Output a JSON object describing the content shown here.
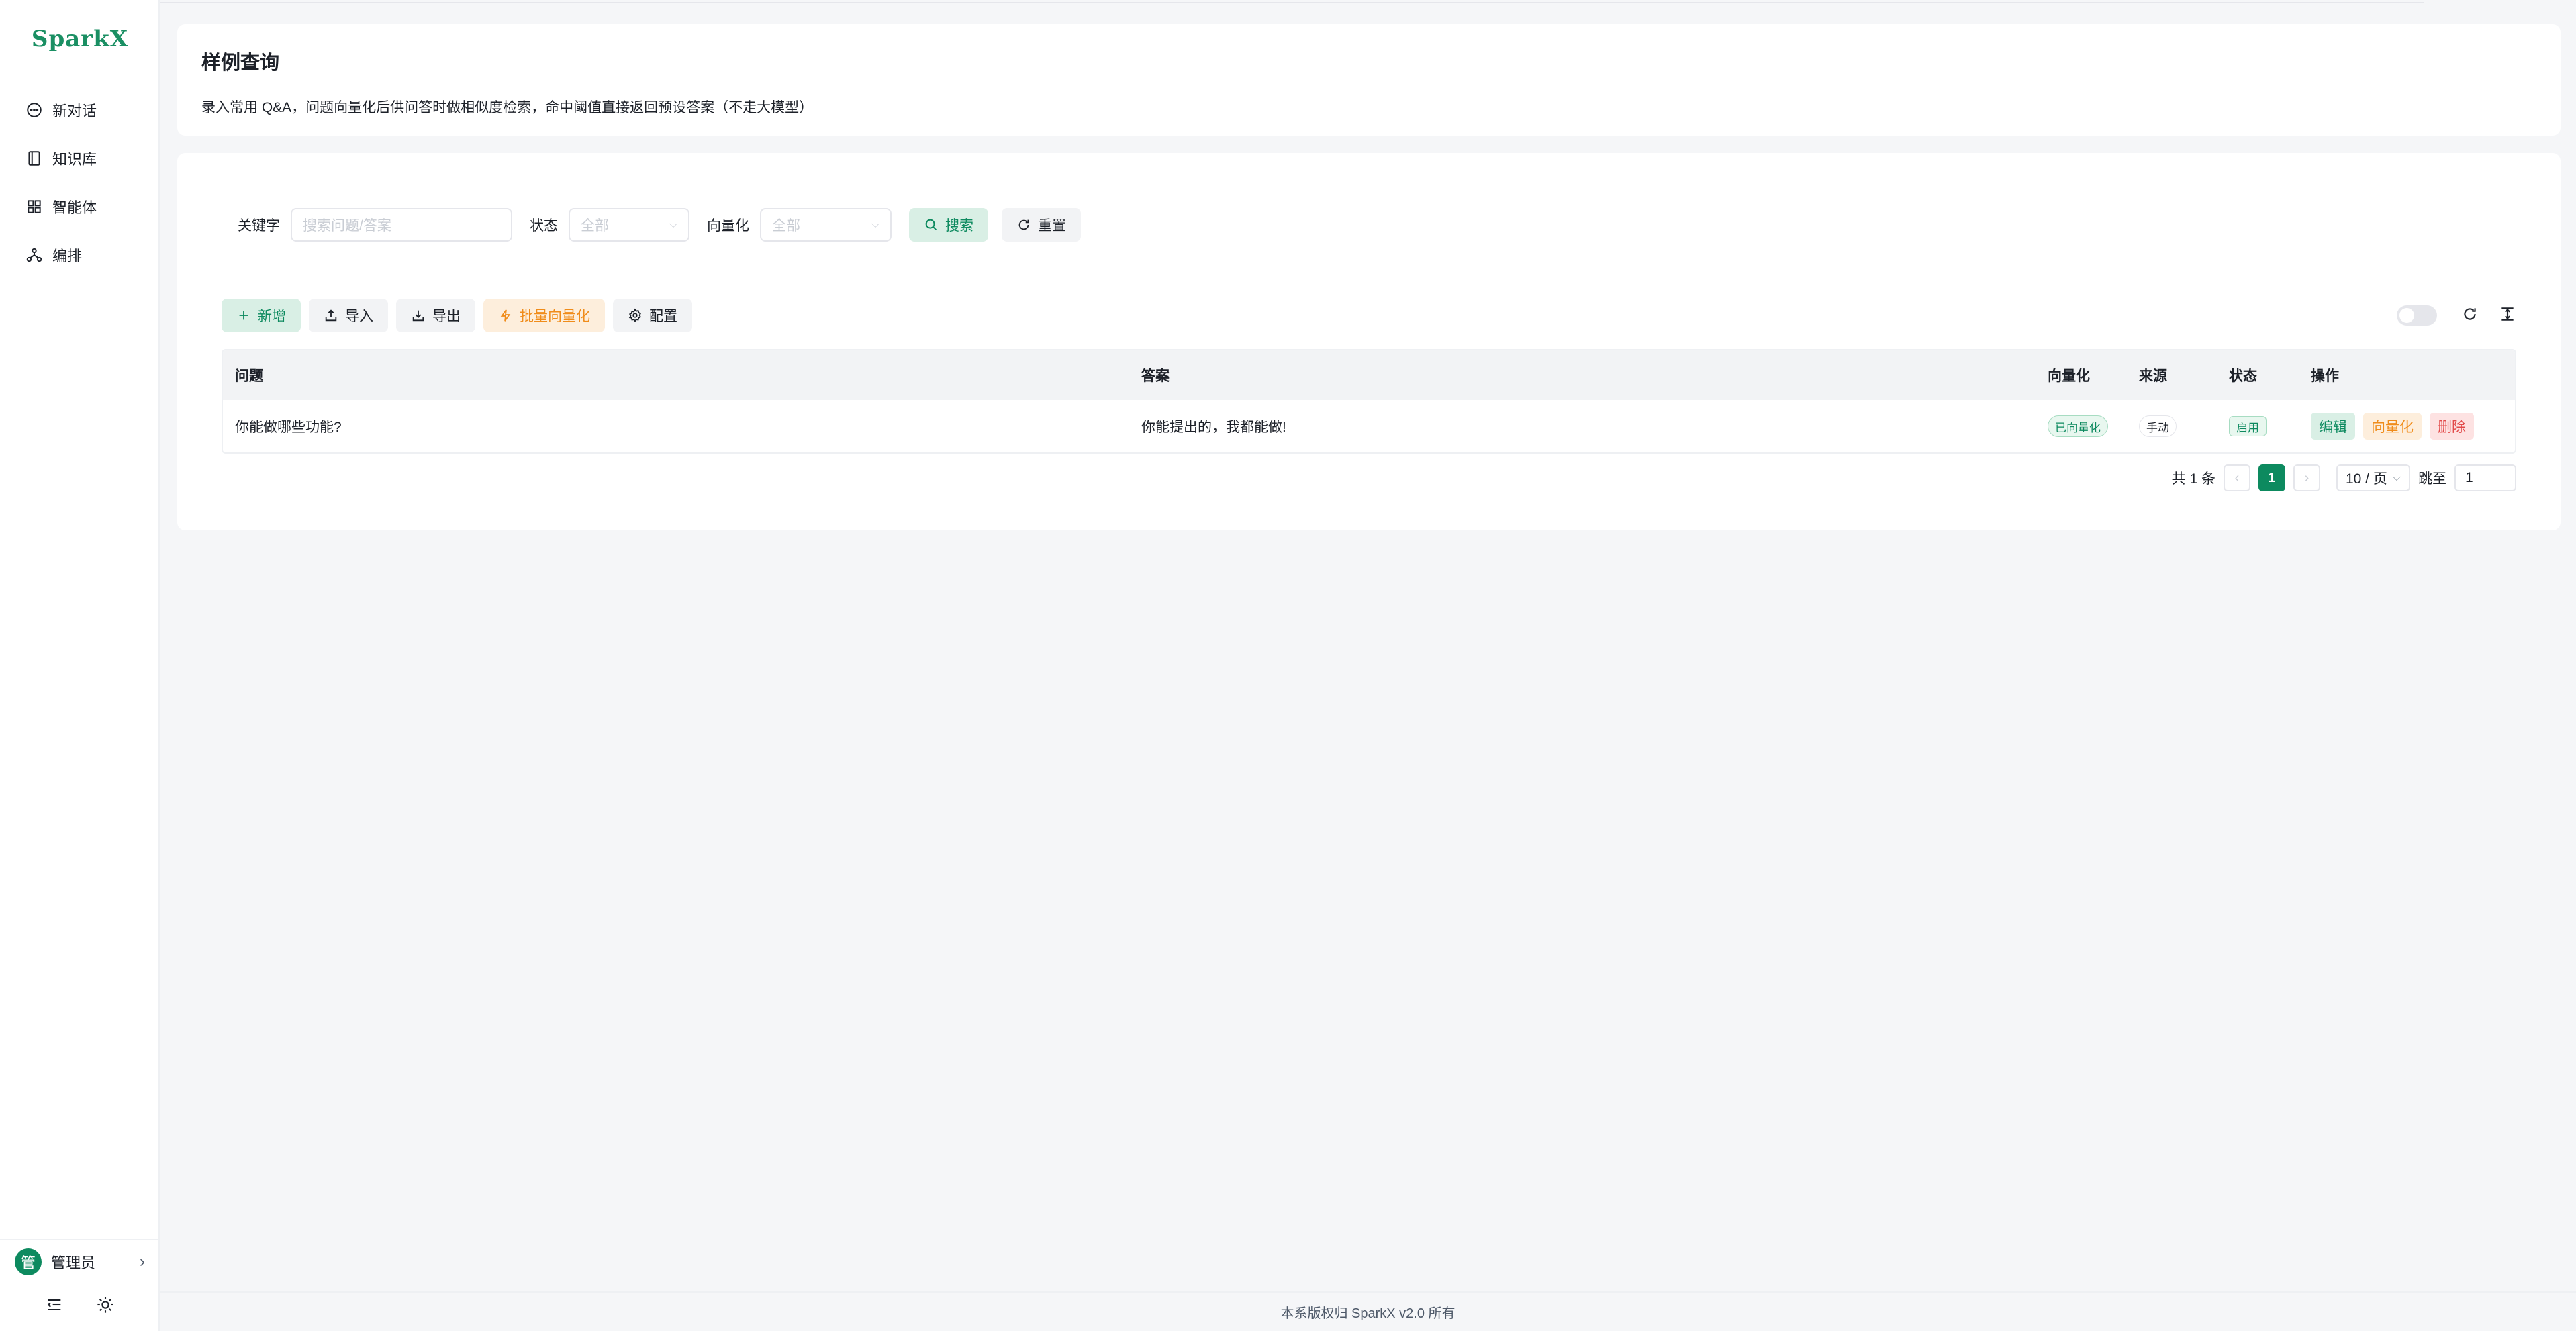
{
  "app": {
    "logo": "SparkX"
  },
  "sidebar": {
    "items": [
      {
        "label": "新对话",
        "icon": "chat-bubble-icon"
      },
      {
        "label": "知识库",
        "icon": "book-icon"
      },
      {
        "label": "智能体",
        "icon": "grid-icon"
      },
      {
        "label": "编排",
        "icon": "workflow-icon"
      }
    ],
    "user": {
      "avatar_text": "管",
      "name": "管理员"
    }
  },
  "page": {
    "title": "样例查询",
    "description": "录入常用 Q&A，问题向量化后供问答时做相似度检索，命中阈值直接返回预设答案（不走大模型）"
  },
  "filters": {
    "keyword_label": "关键字",
    "keyword_placeholder": "搜索问题/答案",
    "status_label": "状态",
    "status_value": "全部",
    "vector_label": "向量化",
    "vector_value": "全部",
    "search_label": "搜索",
    "reset_label": "重置"
  },
  "toolbar": {
    "add": "新增",
    "import": "导入",
    "export": "导出",
    "batch_vector": "批量向量化",
    "config": "配置"
  },
  "table": {
    "headers": [
      "问题",
      "答案",
      "向量化",
      "来源",
      "状态",
      "操作"
    ],
    "rows": [
      {
        "question": "你能做哪些功能?",
        "answer": "你能提出的，我都能做!",
        "vector": "已向量化",
        "source": "手动",
        "status": "启用",
        "actions": [
          "编辑",
          "向量化",
          "删除"
        ]
      }
    ]
  },
  "pagination": {
    "total": "共 1 条",
    "current": "1",
    "page_size": "10 / 页",
    "jump_label": "跳至",
    "jump_value": "1"
  },
  "footer": {
    "text": "本系版权归 SparkX v2.0 所有"
  },
  "colors": {
    "brand": "#0d8a5f",
    "warning": "#f08c1a",
    "danger": "#e24a4a"
  }
}
